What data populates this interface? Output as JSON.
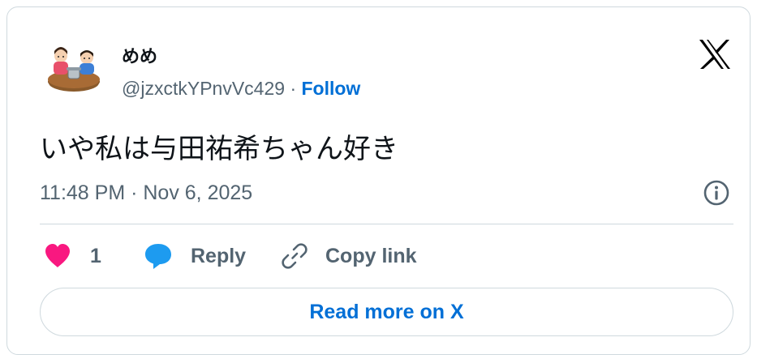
{
  "tweet": {
    "author": {
      "display_name": "めめ",
      "handle": "@jzxctkYPnvVc429",
      "separator": "·",
      "follow_label": "Follow",
      "avatar_icon": "illustration-avatar-icon"
    },
    "text": "いや私は与田祐希ちゃん好き",
    "timestamp": "11:48 PM · Nov 6, 2025"
  },
  "actions": {
    "like_count": "1",
    "reply_label": "Reply",
    "copy_link_label": "Copy link"
  },
  "read_more_label": "Read more on X",
  "icons": {
    "brand": "x-logo-icon",
    "info": "info-icon",
    "like": "heart-icon",
    "reply": "speech-bubble-icon",
    "copy": "link-icon"
  },
  "colors": {
    "heart": "#f91880",
    "reply": "#1d9bf0",
    "link_blue": "#006fd6",
    "muted": "#536471",
    "text": "#0f1419",
    "border": "#cfd9de"
  }
}
